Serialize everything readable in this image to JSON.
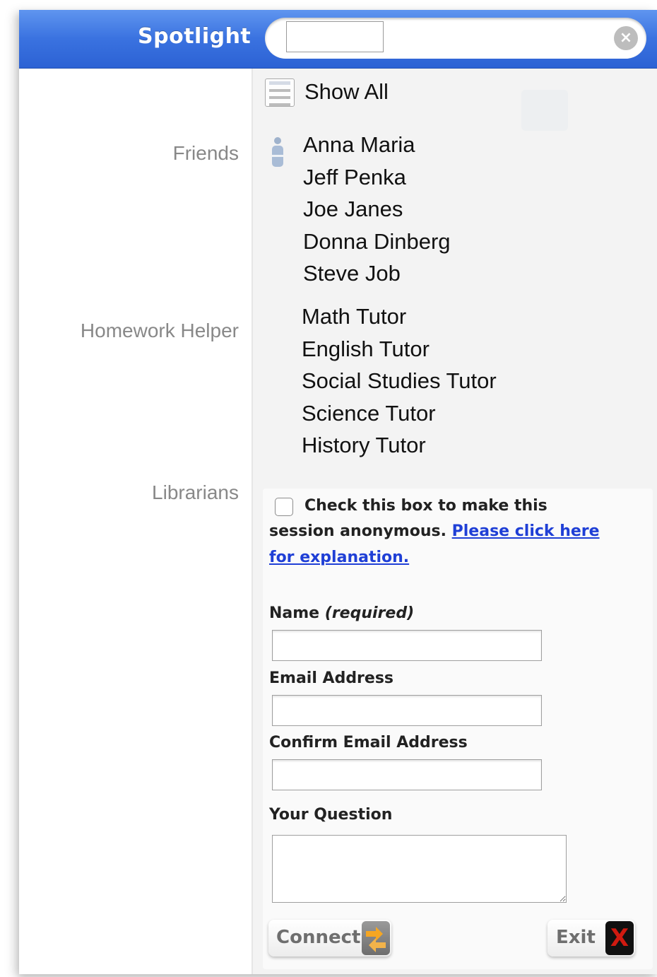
{
  "header": {
    "title": "Spotlight",
    "search": {
      "value": "",
      "placeholder": ""
    }
  },
  "results": {
    "show_all": "Show All",
    "categories": [
      {
        "label": "Friends",
        "items": [
          "Anna Maria",
          "Jeff Penka",
          "Joe Janes",
          "Donna Dinberg",
          "Steve Job"
        ]
      },
      {
        "label": "Homework Helper",
        "items": [
          "Math Tutor",
          "English Tutor",
          "Social Studies Tutor",
          "Science Tutor",
          "History Tutor"
        ]
      },
      {
        "label": "Librarians",
        "items": []
      }
    ]
  },
  "form": {
    "anon_line1": "Check this box to make this",
    "anon_line2": "session anonymous.",
    "link_line1": "Please click here",
    "link_line2": "for explanation.",
    "name_label": "Name",
    "name_required": "(required)",
    "email_label": "Email Address",
    "confirm_label": "Confirm Email Address",
    "question_label": "Your Question",
    "connect_label": "Connect",
    "exit_label": "Exit",
    "exit_icon_glyph": "X"
  },
  "colors": {
    "header_blue": "#3a72e0",
    "link_blue": "#1f3fd6",
    "exit_red": "#d01a10",
    "connect_orange": "#f5a623"
  },
  "icons": {
    "show_all": "document-list-icon",
    "friends": "person-icon",
    "search_clear": "clear-circle-icon",
    "connect": "connect-arrows-icon",
    "exit": "exit-x-icon"
  }
}
